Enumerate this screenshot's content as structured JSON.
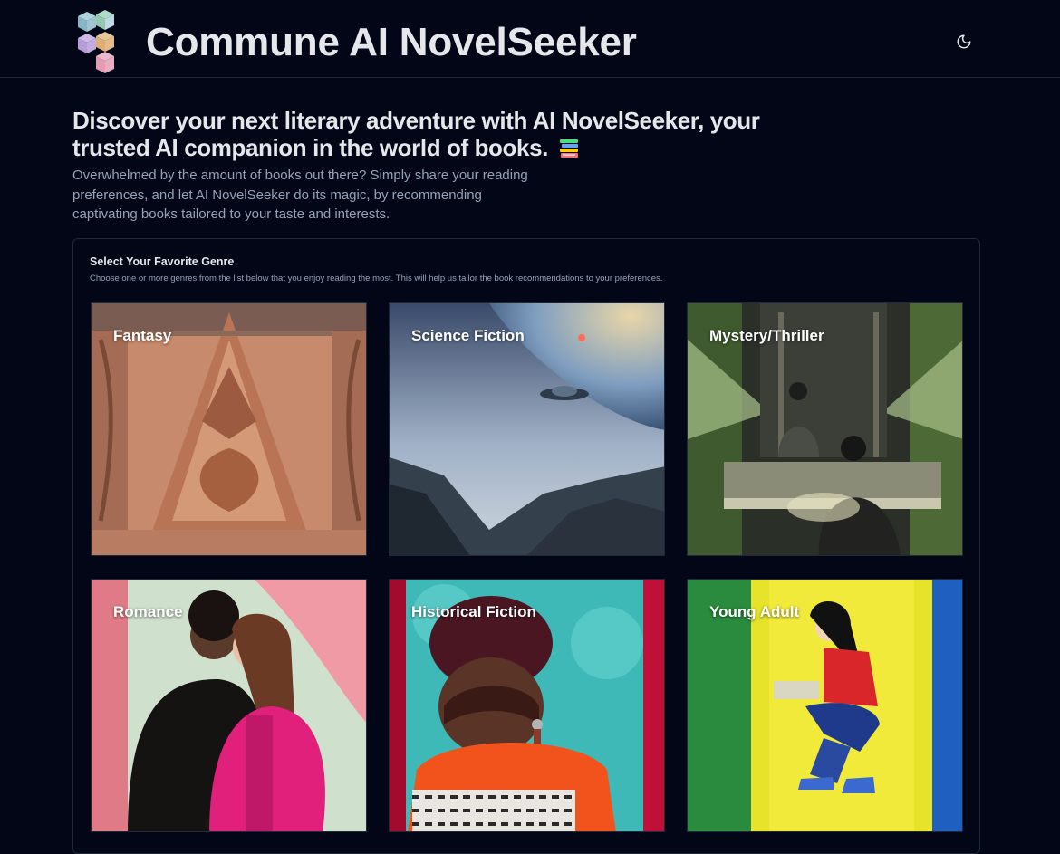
{
  "header": {
    "title": "Commune AI NovelSeeker",
    "theme_toggle_icon": "moon-icon"
  },
  "hero": {
    "title": "Discover your next literary adventure with AI NovelSeeker, your trusted AI companion in the world of books.",
    "title_emoji_icon": "books-icon",
    "description": "Overwhelmed by the amount of books out there? Simply share your reading preferences, and let AI NovelSeeker do its magic, by recommending captivating books tailored to your taste and interests."
  },
  "genre_section": {
    "heading": "Select Your Favorite Genre",
    "subheading": "Choose one or more genres from the list below that you enjoy reading the most. This will help us tailor the book recommendations to your preferences.",
    "genres": [
      {
        "label": "Fantasy"
      },
      {
        "label": "Science Fiction"
      },
      {
        "label": "Mystery/Thriller"
      },
      {
        "label": "Romance"
      },
      {
        "label": "Historical Fiction"
      },
      {
        "label": "Young Adult"
      }
    ]
  },
  "colors": {
    "background": "#020617",
    "border": "#1f2937",
    "text_primary": "#e5e7eb",
    "text_muted": "#94a3b8"
  }
}
